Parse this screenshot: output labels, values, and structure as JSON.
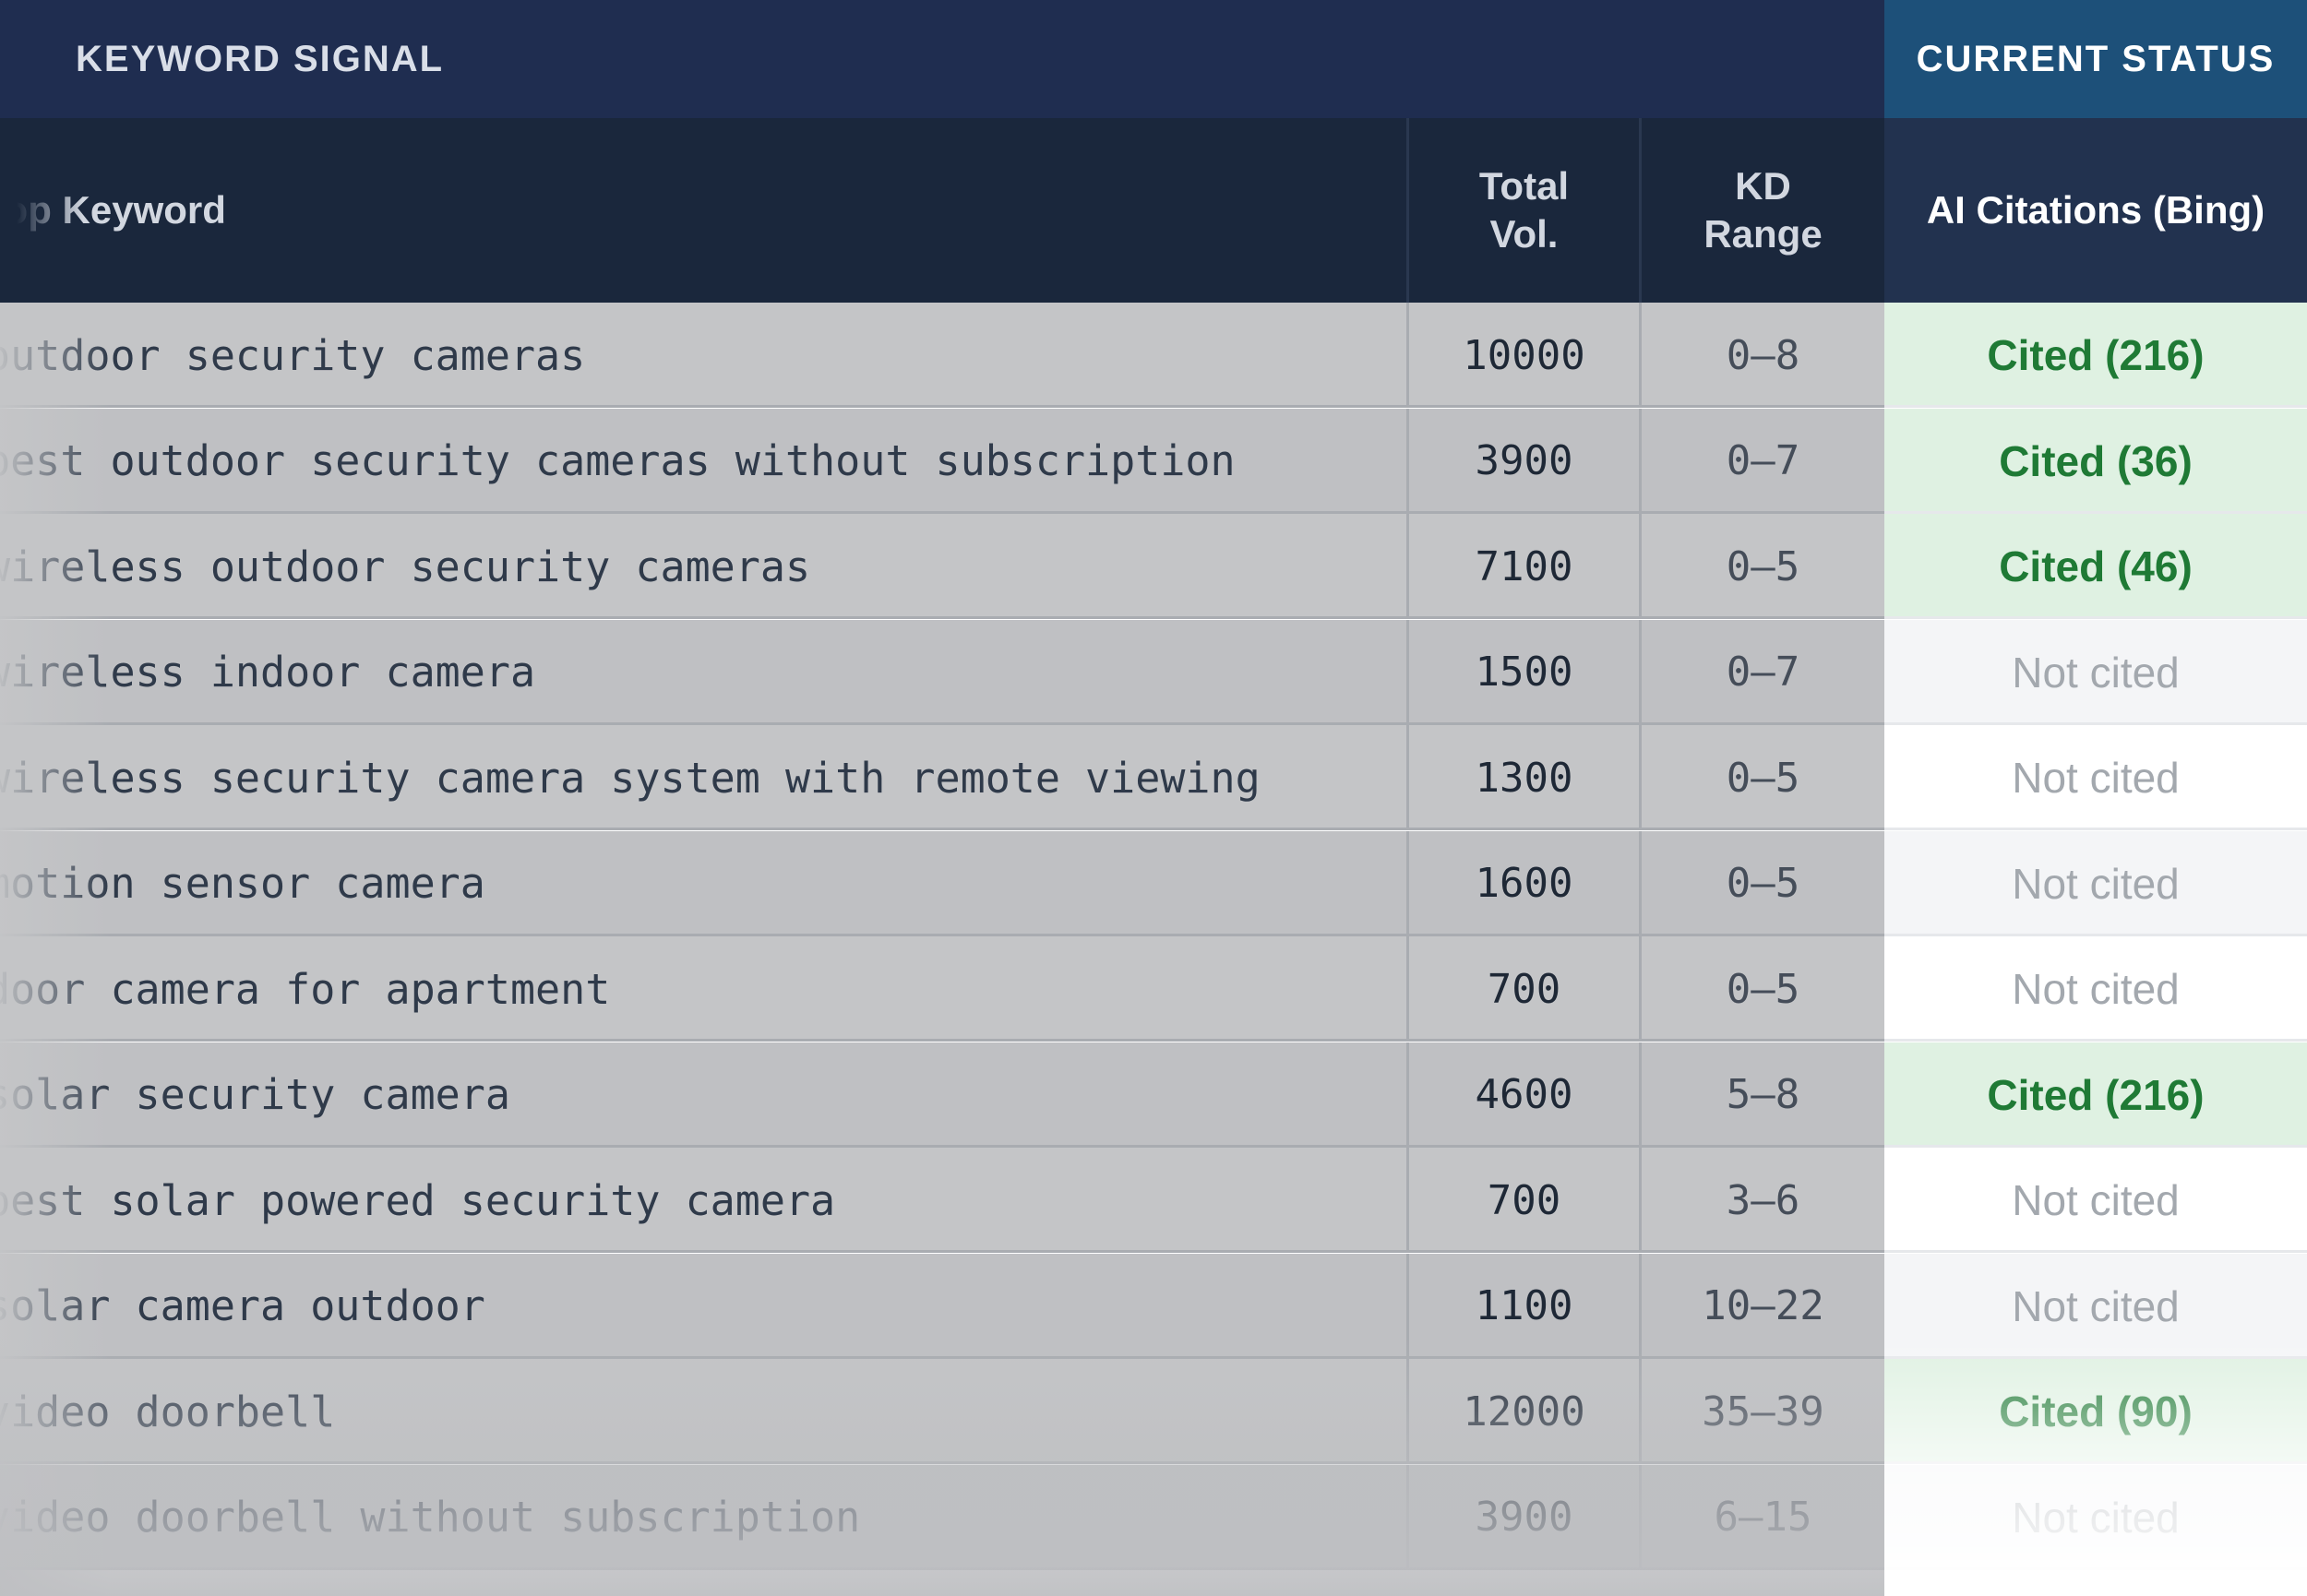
{
  "group_headers": {
    "left": "KEYWORD SIGNAL",
    "right": "CURRENT STATUS"
  },
  "columns": {
    "keyword": "Top Keyword",
    "total_vol": "Total\nVol.",
    "kd_range": "KD\nRange",
    "ai_citations": "AI Citations (Bing)"
  },
  "rows": [
    {
      "keyword": "outdoor security cameras",
      "volume": "10000",
      "kd": "0–8",
      "status": "Cited (216)",
      "cited": true
    },
    {
      "keyword": "best outdoor security cameras without subscription",
      "volume": "3900",
      "kd": "0–7",
      "status": "Cited (36)",
      "cited": true
    },
    {
      "keyword": "wireless outdoor security cameras",
      "volume": "7100",
      "kd": "0–5",
      "status": "Cited (46)",
      "cited": true
    },
    {
      "keyword": "wireless indoor camera",
      "volume": "1500",
      "kd": "0–7",
      "status": "Not cited",
      "cited": false
    },
    {
      "keyword": "wireless security camera system with remote viewing",
      "volume": "1300",
      "kd": "0–5",
      "status": "Not cited",
      "cited": false
    },
    {
      "keyword": "motion sensor camera",
      "volume": "1600",
      "kd": "0–5",
      "status": "Not cited",
      "cited": false
    },
    {
      "keyword": "door camera for apartment",
      "volume": "700",
      "kd": "0–5",
      "status": "Not cited",
      "cited": false
    },
    {
      "keyword": "solar security camera",
      "volume": "4600",
      "kd": "5–8",
      "status": "Cited (216)",
      "cited": true
    },
    {
      "keyword": "best solar powered security camera",
      "volume": "700",
      "kd": "3–6",
      "status": "Not cited",
      "cited": false
    },
    {
      "keyword": "solar camera outdoor",
      "volume": "1100",
      "kd": "10–22",
      "status": "Not cited",
      "cited": false
    },
    {
      "keyword": "video doorbell",
      "volume": "12000",
      "kd": "35–39",
      "status": "Cited (90)",
      "cited": true
    },
    {
      "keyword": "video doorbell without subscription",
      "volume": "3900",
      "kd": "6–15",
      "status": "Not cited",
      "cited": false
    }
  ],
  "colors": {
    "header_left": "#1f2d50",
    "header_right": "#1d5079",
    "cited_bg": "#dff1e2",
    "cited_text": "#1f7a35",
    "not_cited_text": "#a3a8ae"
  }
}
